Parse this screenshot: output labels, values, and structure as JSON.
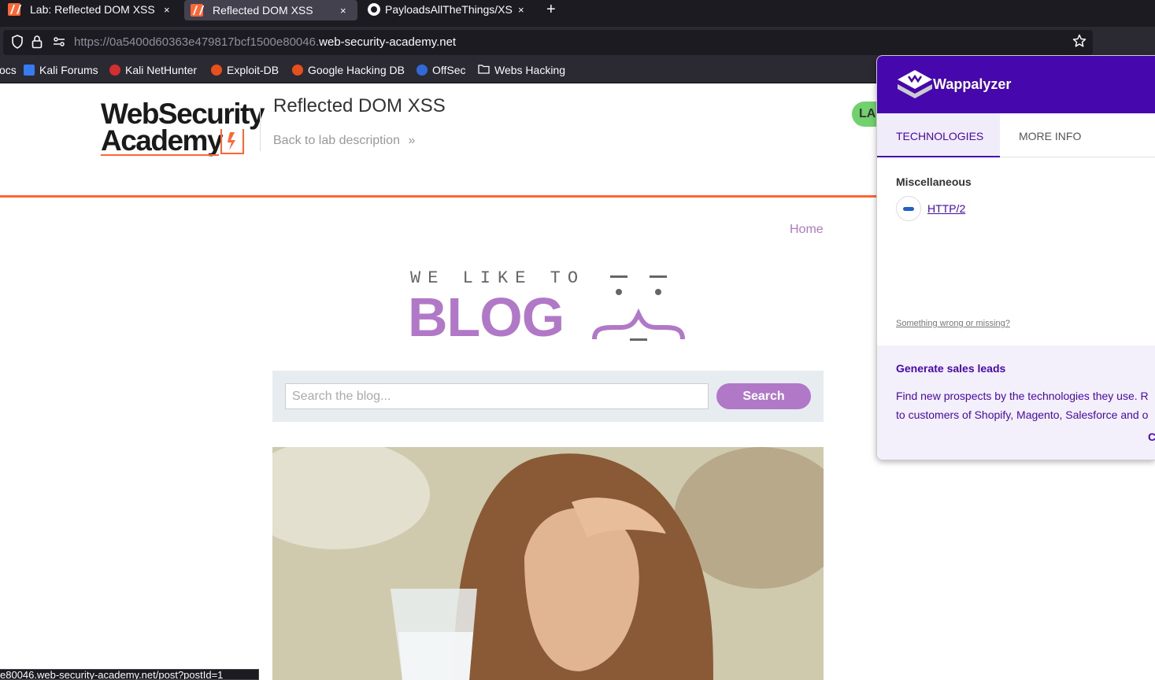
{
  "tabs": [
    {
      "title": "Lab: Reflected DOM XSS |",
      "close": "×"
    },
    {
      "title": "Reflected DOM XSS",
      "close": "×"
    },
    {
      "title": "PayloadsAllTheThings/XS",
      "close": "×"
    }
  ],
  "new_tab": "+",
  "address": {
    "url_prefix": "https://0a5400d60363e479817bcf1500e80046.",
    "url_domain": "web-security-academy.net"
  },
  "bookmarks": [
    "ocs",
    "Kali Forums",
    "Kali NetHunter",
    "Exploit-DB",
    "Google Hacking DB",
    "OffSec",
    "Webs Hacking"
  ],
  "lab": {
    "logo_line1": "WebSecurity",
    "logo_line2": "Academy",
    "title": "Reflected DOM XSS",
    "back_link": "Back to lab description",
    "back_chevron": "»",
    "status": "LA"
  },
  "site": {
    "nav_home": "Home",
    "banner_top": "WE LIKE TO",
    "banner_main": "BLOG",
    "search_placeholder": "Search the blog...",
    "search_button": "Search"
  },
  "status_bar": {
    "url": "e80046.web-security-academy.net/post?postId=1"
  },
  "wappalyzer": {
    "brand": "Wappalyzer",
    "tabs": [
      "TECHNOLOGIES",
      "MORE INFO"
    ],
    "category": "Miscellaneous",
    "technology": "HTTP/2",
    "wrong_link": "Something wrong or missing?",
    "promo_title": "Generate sales leads",
    "promo_line1": "Find new prospects by the technologies they use. R",
    "promo_line2": "to customers of Shopify, Magento, Salesforce and o",
    "promo_cta": "C"
  },
  "colors": {
    "accent_orange": "#ff6633",
    "blog_purple": "#b178c7",
    "wappalyzer_purple": "#4608ad",
    "lab_status_green": "#70d16d"
  }
}
